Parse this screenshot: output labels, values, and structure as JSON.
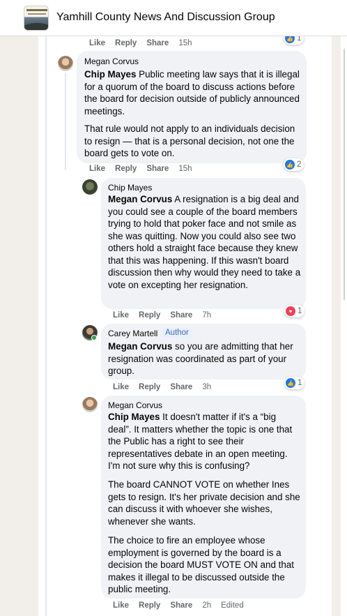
{
  "group": {
    "title": "Yamhill County News And Discussion Group"
  },
  "comments": [
    {
      "author": "",
      "mention": "",
      "paragraphs": [],
      "actions": {
        "like": "Like",
        "reply": "Reply",
        "share": "Share",
        "time": "15h"
      },
      "reaction": {
        "type": "like",
        "count": "1"
      }
    },
    {
      "author": "Megan Corvus",
      "mention": "Chip Mayes",
      "paragraphs": [
        "Public meeting law says that it is illegal for a quorum of the board to discuss actions before the board for decision outside of publicly announced meetings.",
        "That rule would not apply to an individuals decision to resign — that is a personal decision, not one the board gets to vote on."
      ],
      "actions": {
        "like": "Like",
        "reply": "Reply",
        "share": "Share",
        "time": "15h"
      },
      "reaction": {
        "type": "like",
        "count": "2"
      }
    },
    {
      "author": "Chip Mayes",
      "mention": "Megan Corvus",
      "paragraphs": [
        "A resignation is a big deal and you could see a couple of the board members trying to hold that poker face and not smile as she was quitting. Now you could also see two others hold a straight face because they knew that this was happening. If this wasn't board discussion then why would they need to take a vote on excepting her resignation."
      ],
      "actions": {
        "like": "Like",
        "reply": "Reply",
        "share": "Share",
        "time": "7h"
      },
      "reaction": {
        "type": "love",
        "count": "1"
      }
    },
    {
      "author": "Carey Martell",
      "badge": "Author",
      "mention": "Megan Corvus",
      "paragraphs": [
        "so you are admitting that her resignation was coordinated as part of your group."
      ],
      "actions": {
        "like": "Like",
        "reply": "Reply",
        "share": "Share",
        "time": "3h"
      },
      "reaction": {
        "type": "like",
        "count": "1"
      }
    },
    {
      "author": "Megan Corvus",
      "mention": "Chip Mayes",
      "paragraphs": [
        "It doesn't matter if it's a “big deal”. It matters whether the topic is one that the Public has a right to see their representatives debate in an open meeting. I'm not sure why this is confusing?",
        "The board CANNOT VOTE on whether Ines gets to resign. It's her private decision and she can discuss it with whoever she wishes, whenever she wants.",
        "The choice to fire an employee whose employment is governed by the board is a decision the board MUST VOTE ON and that makes it illegal to be discussed outside the public meeting."
      ],
      "actions": {
        "like": "Like",
        "reply": "Reply",
        "share": "Share",
        "time": "2h",
        "edited": "Edited"
      }
    }
  ],
  "colors": {
    "accent": "#1877f2",
    "love": "#f33e58",
    "bubble": "#f0f2f5",
    "muted": "#65676b"
  },
  "icons": {
    "like": "thumbs-up-icon",
    "love": "heart-icon"
  }
}
